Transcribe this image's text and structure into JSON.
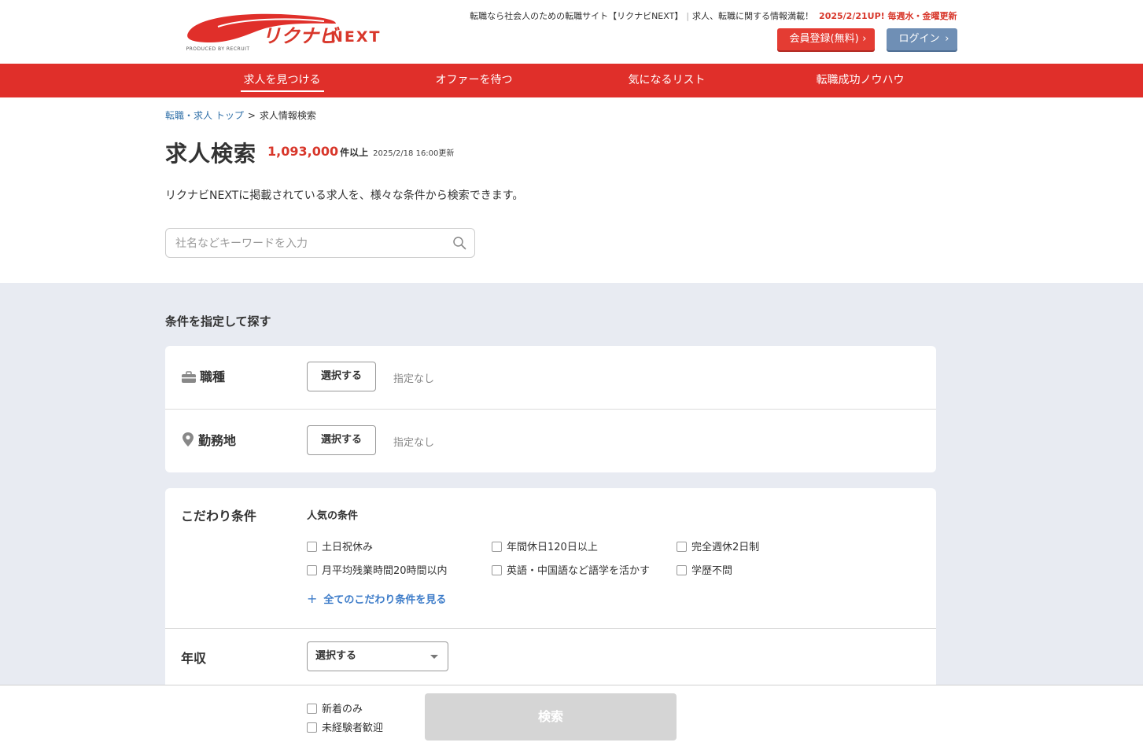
{
  "header": {
    "logo_text": "リクナビNEXT",
    "produced_by": "PRODUCED BY RECRUIT",
    "tagline": "転職なら社会人のための転職サイト【リクナビNEXT】",
    "tagline2": "求人、転職に関する情報満載！",
    "update_note": "2025/2/21UP! 毎週水・金曜更新",
    "register_button": "会員登録(無料)",
    "login_button": "ログイン",
    "brand_color": "#e02f2a"
  },
  "nav": {
    "items": [
      {
        "label": "求人を見つける"
      },
      {
        "label": "オファーを待つ"
      },
      {
        "label": "気になるリスト"
      },
      {
        "label": "転職成功ノウハウ"
      }
    ]
  },
  "breadcrumb": {
    "top": "転職・求人 トップ",
    "separator": ">",
    "current": "求人情報検索"
  },
  "main": {
    "title": "求人検索",
    "count": "1,093,000",
    "count_unit": "件以上",
    "updated": "2025/2/18 16:00更新",
    "description": "リクナビNEXTに掲載されている求人を、様々な条件から検索できます。",
    "search_placeholder": "社名などキーワードを入力"
  },
  "conditions": {
    "heading": "条件を指定して探す",
    "job_type": {
      "label": "職種",
      "button": "選択する",
      "value": "指定なし"
    },
    "location": {
      "label": "勤務地",
      "button": "選択する",
      "value": "指定なし"
    },
    "preferences": {
      "label": "こだわり条件",
      "subheading": "人気の条件",
      "options": [
        "土日祝休み",
        "年間休日120日以上",
        "完全週休2日制",
        "月平均残業時間20時間以内",
        "英語・中国語など語学を活かす",
        "学歴不問"
      ],
      "more_link": "全てのこだわり条件を見る"
    },
    "salary": {
      "label": "年収",
      "select_value": "選択する"
    }
  },
  "bottom": {
    "new_only": "新着のみ",
    "inexperienced": "未経験者歓迎",
    "search_button": "検索"
  }
}
